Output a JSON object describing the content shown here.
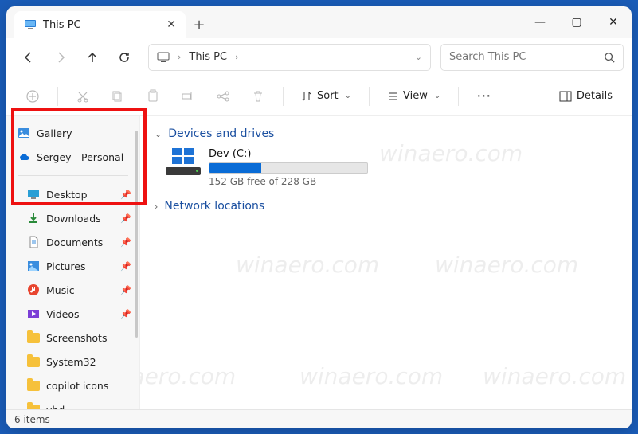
{
  "window": {
    "tab_title": "This PC",
    "new_tab_tooltip": "+"
  },
  "nav": {
    "address_label": "This PC"
  },
  "search": {
    "placeholder": "Search This PC"
  },
  "toolbar": {
    "sort_label": "Sort",
    "view_label": "View",
    "details_label": "Details"
  },
  "sidebar": {
    "gallery": "Gallery",
    "onedrive": "Sergey - Personal",
    "desktop": "Desktop",
    "downloads": "Downloads",
    "documents": "Documents",
    "pictures": "Pictures",
    "music": "Music",
    "videos": "Videos",
    "screenshots": "Screenshots",
    "system32": "System32",
    "copilot": "copilot icons",
    "vhd": "vhd"
  },
  "main": {
    "group_devices": "Devices and drives",
    "group_network": "Network locations",
    "drive_name": "Dev (C:)",
    "drive_free": "152 GB free of 228 GB",
    "drive_fill_pct": 33
  },
  "status": {
    "count": "6 items"
  },
  "watermark": "winaero.com"
}
